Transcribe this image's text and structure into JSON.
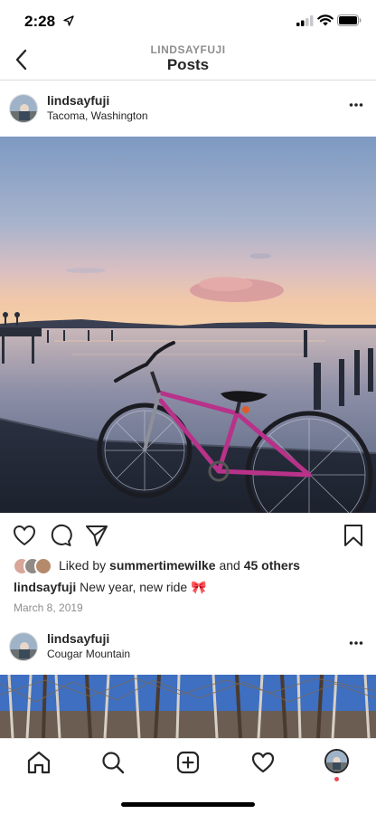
{
  "status_bar": {
    "time": "2:28"
  },
  "header": {
    "subtitle": "LINDSAYFUJI",
    "title": "Posts"
  },
  "post1": {
    "username": "lindsayfuji",
    "location": "Tacoma, Washington",
    "liked_by_prefix": "Liked by",
    "liked_by_user": "summertimewilke",
    "liked_by_and": "and",
    "liked_by_others": "45 others",
    "caption_user": "lindsayfuji",
    "caption_text": "New year, new ride 🎀",
    "date": "March 8, 2019"
  },
  "post2": {
    "username": "lindsayfuji",
    "location": "Cougar Mountain"
  },
  "icons": {
    "back": "chevron-left-icon",
    "more": "more-dots-icon",
    "like": "heart-icon",
    "comment": "comment-icon",
    "share": "send-icon",
    "save": "bookmark-icon",
    "home": "home-icon",
    "search": "search-icon",
    "create": "add-post-icon",
    "activity": "heart-icon",
    "profile": "profile-avatar"
  },
  "colors": {
    "text": "#262626",
    "secondary": "#8e8e8e",
    "notification": "#ed4956"
  }
}
